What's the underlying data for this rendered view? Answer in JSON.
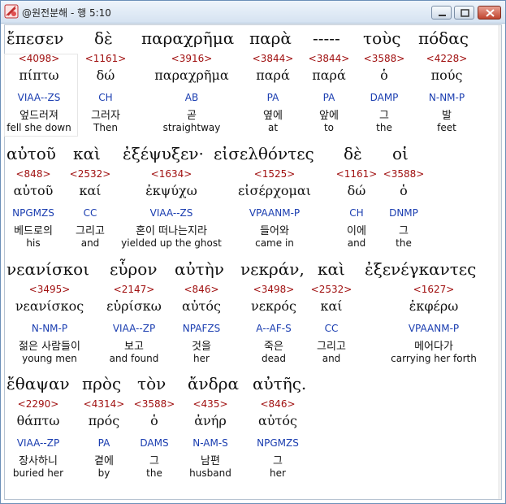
{
  "window": {
    "title": "@원전분해 - 행 5:10"
  },
  "icons": {
    "app": "app-icon",
    "minimize": "minimize-icon",
    "maximize": "maximize-icon",
    "close": "close-icon"
  },
  "lines": [
    {
      "greek": [
        "ἔπεσεν",
        "δὲ",
        "παραχρῆμα",
        "παρὰ",
        "-----",
        "τοὺς",
        "πόδας"
      ],
      "words": [
        {
          "strong": "<4098>",
          "lemma": "πίπτω",
          "morph": "VIAA--ZS",
          "kor": "엎드러져",
          "eng": "fell she down"
        },
        {
          "strong": "<1161>",
          "lemma": "δώ",
          "morph": "CH",
          "kor": "그러자",
          "eng": "Then"
        },
        {
          "strong": "<3916>",
          "lemma": "παραχρῆμα",
          "morph": "AB",
          "kor": "곧",
          "eng": "straightway"
        },
        {
          "strong": "<3844>",
          "lemma": "παρά",
          "morph": "PA",
          "kor": "옆에",
          "eng": "at"
        },
        {
          "strong": "<3844>",
          "lemma": "παρά",
          "morph": "PA",
          "kor": "앞에",
          "eng": "to"
        },
        {
          "strong": "<3588>",
          "lemma": "ὁ",
          "morph": "DAMP",
          "kor": "그",
          "eng": "the"
        },
        {
          "strong": "<4228>",
          "lemma": "πούς",
          "morph": "N-NM-P",
          "kor": "발",
          "eng": "feet"
        }
      ]
    },
    {
      "greek": [
        "αὐτοῦ",
        "καὶ",
        "ἐξέψυξεν·",
        "εἰσελθόντες",
        "δὲ",
        "οἱ"
      ],
      "words": [
        {
          "strong": "<848>",
          "lemma": "αὐτοῦ",
          "morph": "NPGMZS",
          "kor": "베드로의",
          "eng": "his"
        },
        {
          "strong": "<2532>",
          "lemma": "καί",
          "morph": "CC",
          "kor": "그리고",
          "eng": "and"
        },
        {
          "strong": "<1634>",
          "lemma": "ἐκψύχω",
          "morph": "VIAA--ZS",
          "kor": "혼이 떠나는지라",
          "eng": "yielded up the ghost"
        },
        {
          "strong": "<1525>",
          "lemma": "εἰσέρχομαι",
          "morph": "VPAANM-P",
          "kor": "들어와",
          "eng": "came in"
        },
        {
          "strong": "<1161>",
          "lemma": "δώ",
          "morph": "CH",
          "kor": "이에",
          "eng": "and"
        },
        {
          "strong": "<3588>",
          "lemma": "ὁ",
          "morph": "DNMP",
          "kor": "그",
          "eng": "the"
        }
      ]
    },
    {
      "greek": [
        "νεανίσκοι",
        "εὗρον",
        "αὐτὴν",
        "νεκράν,",
        "καὶ",
        "ἐξενέγκαντες"
      ],
      "words": [
        {
          "strong": "<3495>",
          "lemma": "νεανίσκος",
          "morph": "N-NM-P",
          "kor": "젊은 사람들이",
          "eng": "young men"
        },
        {
          "strong": "<2147>",
          "lemma": "εὑρίσκω",
          "morph": "VIAA--ZP",
          "kor": "보고",
          "eng": "and found"
        },
        {
          "strong": "<846>",
          "lemma": "αὐτός",
          "morph": "NPAFZS",
          "kor": "것을",
          "eng": "her"
        },
        {
          "strong": "<3498>",
          "lemma": "νεκρός",
          "morph": "A--AF-S",
          "kor": "죽은",
          "eng": "dead"
        },
        {
          "strong": "<2532>",
          "lemma": "καί",
          "morph": "CC",
          "kor": "그리고",
          "eng": "and"
        },
        {
          "strong": "<1627>",
          "lemma": "ἐκφέρω",
          "morph": "VPAANM-P",
          "kor": "메어다가",
          "eng": "carrying her forth"
        }
      ]
    },
    {
      "greek": [
        "ἔθαψαν",
        "πρὸς",
        "τὸν",
        "ἄνδρα",
        "αὐτῆς."
      ],
      "words": [
        {
          "strong": "<2290>",
          "lemma": "θάπτω",
          "morph": "VIAA--ZP",
          "kor": "장사하니",
          "eng": "buried her"
        },
        {
          "strong": "<4314>",
          "lemma": "πρός",
          "morph": "PA",
          "kor": "곁에",
          "eng": "by"
        },
        {
          "strong": "<3588>",
          "lemma": "ὁ",
          "morph": "DAMS",
          "kor": "그",
          "eng": "the"
        },
        {
          "strong": "<435>",
          "lemma": "ἀνήρ",
          "morph": "N-AM-S",
          "kor": "남편",
          "eng": "husband"
        },
        {
          "strong": "<846>",
          "lemma": "αὐτός",
          "morph": "NPGMZS",
          "kor": "그",
          "eng": "her"
        }
      ]
    }
  ]
}
